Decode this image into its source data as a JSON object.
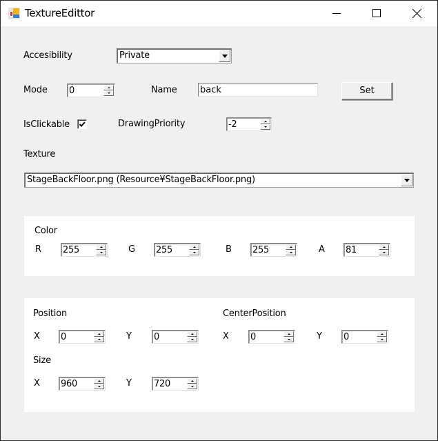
{
  "window": {
    "title": "TextureEdittor",
    "icon": "app-icon",
    "controls": {
      "minimize": "minimize-icon",
      "maximize": "maximize-icon",
      "close": "close-icon"
    }
  },
  "form": {
    "accessibility": {
      "label": "Accesibility",
      "value": "Private"
    },
    "mode": {
      "label": "Mode",
      "value": "0"
    },
    "name": {
      "label": "Name",
      "value": "back"
    },
    "set_button": "Set",
    "is_clickable": {
      "label": "IsClickable",
      "checked": true
    },
    "drawing_priority": {
      "label": "DrawingPriority",
      "value": "-2"
    },
    "texture": {
      "label": "Texture",
      "value": "StageBackFloor.png (Resource¥StageBackFloor.png)"
    }
  },
  "color": {
    "title": "Color",
    "r": {
      "label": "R",
      "value": "255"
    },
    "g": {
      "label": "G",
      "value": "255"
    },
    "b": {
      "label": "B",
      "value": "255"
    },
    "a": {
      "label": "A",
      "value": "81"
    }
  },
  "transform": {
    "position": {
      "title": "Position",
      "x": {
        "label": "X",
        "value": "0"
      },
      "y": {
        "label": "Y",
        "value": "0"
      }
    },
    "center_position": {
      "title": "CenterPosition",
      "x": {
        "label": "X",
        "value": "0"
      },
      "y": {
        "label": "Y",
        "value": "0"
      }
    },
    "size": {
      "title": "Size",
      "x": {
        "label": "X",
        "value": "960"
      },
      "y": {
        "label": "Y",
        "value": "720"
      }
    }
  }
}
